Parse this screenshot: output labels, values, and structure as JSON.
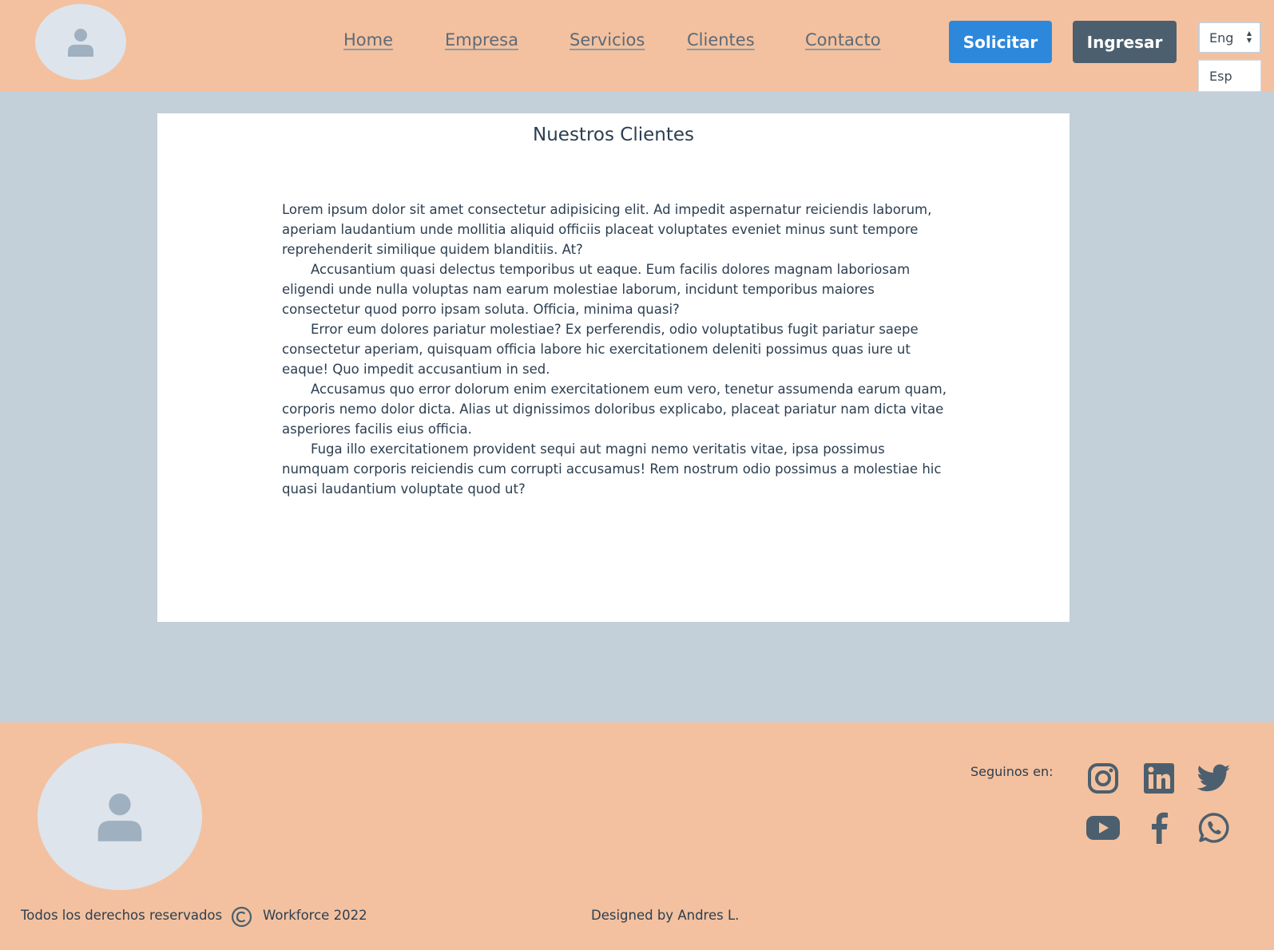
{
  "header": {
    "nav": [
      "Home",
      "Empresa",
      "Servicios",
      "Clientes",
      "Contacto"
    ],
    "solicitar_label": "Solicitar",
    "ingresar_label": "Ingresar",
    "language_selected": "Eng",
    "language_option": "Esp"
  },
  "main": {
    "title": "Nuestros Clientes",
    "paragraphs": [
      "Lorem ipsum dolor sit amet consectetur adipisicing elit. Ad impedit aspernatur reiciendis laborum, aperiam laudantium unde mollitia aliquid officiis placeat voluptates eveniet minus sunt tempore reprehenderit similique quidem blanditiis. At?",
      "Accusantium quasi delectus temporibus ut eaque. Eum facilis dolores magnam laboriosam eligendi unde nulla voluptas nam earum molestiae laborum, incidunt temporibus maiores consectetur quod porro ipsam soluta. Officia, minima quasi?",
      "Error eum dolores pariatur molestiae? Ex perferendis, odio voluptatibus fugit pariatur saepe consectetur aperiam, quisquam officia labore hic exercitationem deleniti possimus quas iure ut eaque! Quo impedit accusantium in sed.",
      "Accusamus quo error dolorum enim exercitationem eum vero, tenetur assumenda earum quam, corporis nemo dolor dicta. Alias ut dignissimos doloribus explicabo, placeat pariatur nam dicta vitae asperiores facilis eius officia.",
      "Fuga illo exercitationem provident sequi aut magni nemo veritatis vitae, ipsa possimus numquam corporis reiciendis cum corrupti accusamus! Rem nostrum odio possimus a molestiae hic quasi laudantium voluptate quod ut?"
    ]
  },
  "footer": {
    "follow_label": "Seguinos en:",
    "social_icons": [
      "instagram-icon",
      "linkedin-icon",
      "twitter-icon",
      "youtube-icon",
      "facebook-icon",
      "whatsapp-icon"
    ],
    "rights": "Todos los derechos reservados",
    "company": "Workforce 2022",
    "designer": "Designed by Andres L."
  },
  "colors": {
    "header_footer_bg": "#f3c19f",
    "page_bg": "#c3d0d9",
    "primary_button": "#2d88db",
    "dark_button": "#4c5f6e",
    "icon_color": "#4c5f6e",
    "avatar_bg": "#dde4ec"
  }
}
